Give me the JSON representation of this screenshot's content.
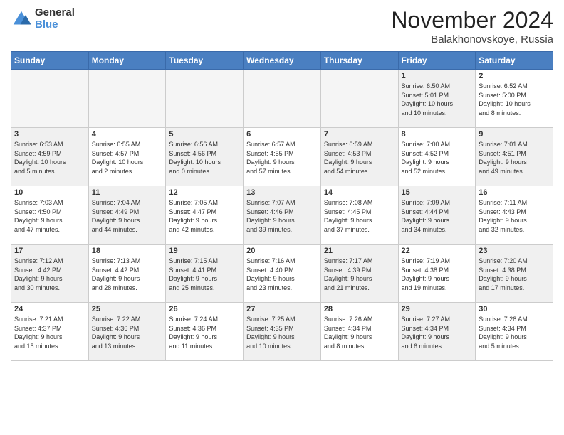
{
  "logo": {
    "general": "General",
    "blue": "Blue"
  },
  "title": "November 2024",
  "location": "Balakhonovskoye, Russia",
  "days_of_week": [
    "Sunday",
    "Monday",
    "Tuesday",
    "Wednesday",
    "Thursday",
    "Friday",
    "Saturday"
  ],
  "weeks": [
    [
      {
        "day": "",
        "info": "",
        "empty": true
      },
      {
        "day": "",
        "info": "",
        "empty": true
      },
      {
        "day": "",
        "info": "",
        "empty": true
      },
      {
        "day": "",
        "info": "",
        "empty": true
      },
      {
        "day": "",
        "info": "",
        "empty": true
      },
      {
        "day": "1",
        "info": "Sunrise: 6:50 AM\nSunset: 5:01 PM\nDaylight: 10 hours\nand 10 minutes.",
        "shaded": true
      },
      {
        "day": "2",
        "info": "Sunrise: 6:52 AM\nSunset: 5:00 PM\nDaylight: 10 hours\nand 8 minutes.",
        "shaded": false
      }
    ],
    [
      {
        "day": "3",
        "info": "Sunrise: 6:53 AM\nSunset: 4:59 PM\nDaylight: 10 hours\nand 5 minutes.",
        "shaded": true
      },
      {
        "day": "4",
        "info": "Sunrise: 6:55 AM\nSunset: 4:57 PM\nDaylight: 10 hours\nand 2 minutes.",
        "shaded": false
      },
      {
        "day": "5",
        "info": "Sunrise: 6:56 AM\nSunset: 4:56 PM\nDaylight: 10 hours\nand 0 minutes.",
        "shaded": true
      },
      {
        "day": "6",
        "info": "Sunrise: 6:57 AM\nSunset: 4:55 PM\nDaylight: 9 hours\nand 57 minutes.",
        "shaded": false
      },
      {
        "day": "7",
        "info": "Sunrise: 6:59 AM\nSunset: 4:53 PM\nDaylight: 9 hours\nand 54 minutes.",
        "shaded": true
      },
      {
        "day": "8",
        "info": "Sunrise: 7:00 AM\nSunset: 4:52 PM\nDaylight: 9 hours\nand 52 minutes.",
        "shaded": false
      },
      {
        "day": "9",
        "info": "Sunrise: 7:01 AM\nSunset: 4:51 PM\nDaylight: 9 hours\nand 49 minutes.",
        "shaded": true
      }
    ],
    [
      {
        "day": "10",
        "info": "Sunrise: 7:03 AM\nSunset: 4:50 PM\nDaylight: 9 hours\nand 47 minutes.",
        "shaded": false
      },
      {
        "day": "11",
        "info": "Sunrise: 7:04 AM\nSunset: 4:49 PM\nDaylight: 9 hours\nand 44 minutes.",
        "shaded": true
      },
      {
        "day": "12",
        "info": "Sunrise: 7:05 AM\nSunset: 4:47 PM\nDaylight: 9 hours\nand 42 minutes.",
        "shaded": false
      },
      {
        "day": "13",
        "info": "Sunrise: 7:07 AM\nSunset: 4:46 PM\nDaylight: 9 hours\nand 39 minutes.",
        "shaded": true
      },
      {
        "day": "14",
        "info": "Sunrise: 7:08 AM\nSunset: 4:45 PM\nDaylight: 9 hours\nand 37 minutes.",
        "shaded": false
      },
      {
        "day": "15",
        "info": "Sunrise: 7:09 AM\nSunset: 4:44 PM\nDaylight: 9 hours\nand 34 minutes.",
        "shaded": true
      },
      {
        "day": "16",
        "info": "Sunrise: 7:11 AM\nSunset: 4:43 PM\nDaylight: 9 hours\nand 32 minutes.",
        "shaded": false
      }
    ],
    [
      {
        "day": "17",
        "info": "Sunrise: 7:12 AM\nSunset: 4:42 PM\nDaylight: 9 hours\nand 30 minutes.",
        "shaded": true
      },
      {
        "day": "18",
        "info": "Sunrise: 7:13 AM\nSunset: 4:42 PM\nDaylight: 9 hours\nand 28 minutes.",
        "shaded": false
      },
      {
        "day": "19",
        "info": "Sunrise: 7:15 AM\nSunset: 4:41 PM\nDaylight: 9 hours\nand 25 minutes.",
        "shaded": true
      },
      {
        "day": "20",
        "info": "Sunrise: 7:16 AM\nSunset: 4:40 PM\nDaylight: 9 hours\nand 23 minutes.",
        "shaded": false
      },
      {
        "day": "21",
        "info": "Sunrise: 7:17 AM\nSunset: 4:39 PM\nDaylight: 9 hours\nand 21 minutes.",
        "shaded": true
      },
      {
        "day": "22",
        "info": "Sunrise: 7:19 AM\nSunset: 4:38 PM\nDaylight: 9 hours\nand 19 minutes.",
        "shaded": false
      },
      {
        "day": "23",
        "info": "Sunrise: 7:20 AM\nSunset: 4:38 PM\nDaylight: 9 hours\nand 17 minutes.",
        "shaded": true
      }
    ],
    [
      {
        "day": "24",
        "info": "Sunrise: 7:21 AM\nSunset: 4:37 PM\nDaylight: 9 hours\nand 15 minutes.",
        "shaded": false
      },
      {
        "day": "25",
        "info": "Sunrise: 7:22 AM\nSunset: 4:36 PM\nDaylight: 9 hours\nand 13 minutes.",
        "shaded": true
      },
      {
        "day": "26",
        "info": "Sunrise: 7:24 AM\nSunset: 4:36 PM\nDaylight: 9 hours\nand 11 minutes.",
        "shaded": false
      },
      {
        "day": "27",
        "info": "Sunrise: 7:25 AM\nSunset: 4:35 PM\nDaylight: 9 hours\nand 10 minutes.",
        "shaded": true
      },
      {
        "day": "28",
        "info": "Sunrise: 7:26 AM\nSunset: 4:34 PM\nDaylight: 9 hours\nand 8 minutes.",
        "shaded": false
      },
      {
        "day": "29",
        "info": "Sunrise: 7:27 AM\nSunset: 4:34 PM\nDaylight: 9 hours\nand 6 minutes.",
        "shaded": true
      },
      {
        "day": "30",
        "info": "Sunrise: 7:28 AM\nSunset: 4:34 PM\nDaylight: 9 hours\nand 5 minutes.",
        "shaded": false
      }
    ]
  ]
}
